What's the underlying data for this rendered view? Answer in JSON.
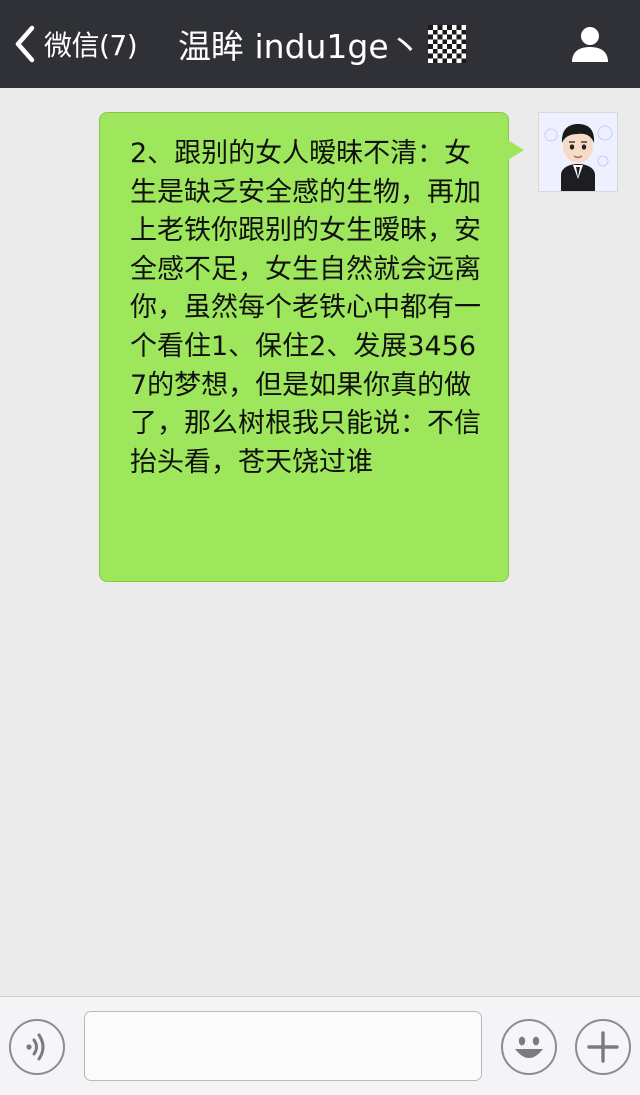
{
  "navbar": {
    "back_label": "微信(7)",
    "title": "温眸 indu1ge丶"
  },
  "messages": [
    {
      "direction": "outgoing",
      "text": "2、跟别的女人暧昧不清：女生是缺乏安全感的生物，再加上老铁你跟别的女生暧昧，安全感不足，女生自然就会远离你，虽然每个老铁心中都有一个看住1、保住2、发展34567的梦想，但是如果你真的做了，那么树根我只能说：不信抬头看，苍天饶过谁"
    }
  ],
  "input": {
    "value": "",
    "placeholder": ""
  },
  "icons": {
    "back": "chevron-left-icon",
    "profile": "person-icon",
    "voice": "voice-icon",
    "emoji": "smiley-icon",
    "plus": "plus-icon"
  },
  "colors": {
    "navbar_bg": "#2f3136",
    "bubble_bg": "#9ee65b",
    "chat_bg": "#ebebeb"
  }
}
